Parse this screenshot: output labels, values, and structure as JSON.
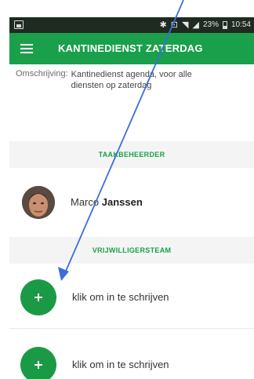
{
  "status_bar": {
    "battery": "23%",
    "time": "10:54"
  },
  "app_bar": {
    "title": "KANTINEDIENST ZATERDAG"
  },
  "description": {
    "label": "Omschrijving:",
    "value": "Kantinedienst agenda, voor alle diensten op zaterdag"
  },
  "sections": {
    "manager": "TAAKBEHEERDER",
    "volunteers": "VRIJWILLIGERSTEAM"
  },
  "manager": {
    "first_name": "Marco",
    "last_name": "Janssen"
  },
  "join_slots": [
    {
      "label": "klik om in te schrijven"
    },
    {
      "label": "klik om in te schrijven"
    }
  ],
  "colors": {
    "brand_green": "#1aa04b",
    "annotation_blue": "#3a6fd8"
  }
}
